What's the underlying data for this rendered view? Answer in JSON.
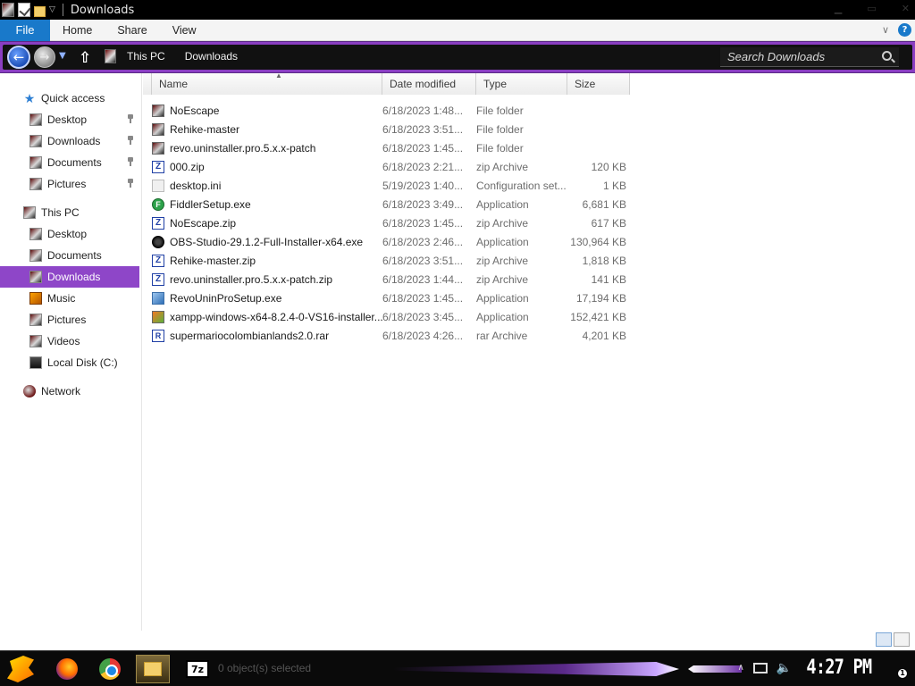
{
  "window": {
    "title": "Downloads",
    "controls": [
      "minimize-icon",
      "maximize-icon",
      "close-icon"
    ]
  },
  "ribbon": {
    "tabs": [
      {
        "label": "File",
        "active": true
      },
      {
        "label": "Home"
      },
      {
        "label": "Share"
      },
      {
        "label": "View"
      }
    ]
  },
  "addressbar": {
    "crumbs": [
      "This PC",
      "Downloads"
    ],
    "search_placeholder": "Search Downloads"
  },
  "sidebar": {
    "items": [
      {
        "label": "Quick access",
        "icon": "star-icon",
        "level": 0,
        "pinned": false
      },
      {
        "label": "Desktop",
        "icon": "desktop-icon",
        "level": 1,
        "pinned": true
      },
      {
        "label": "Downloads",
        "icon": "downloads-icon",
        "level": 1,
        "pinned": true
      },
      {
        "label": "Documents",
        "icon": "documents-icon",
        "level": 1,
        "pinned": true
      },
      {
        "label": "Pictures",
        "icon": "pictures-icon",
        "level": 1,
        "pinned": true
      },
      {
        "label": "This PC",
        "icon": "pc-icon",
        "level": 0,
        "pinned": false
      },
      {
        "label": "Desktop",
        "icon": "desktop-icon",
        "level": 1,
        "pinned": false
      },
      {
        "label": "Documents",
        "icon": "documents-icon",
        "level": 1,
        "pinned": false
      },
      {
        "label": "Downloads",
        "icon": "downloads-icon",
        "level": 1,
        "pinned": false,
        "selected": true
      },
      {
        "label": "Music",
        "icon": "music-icon",
        "level": 1,
        "pinned": false
      },
      {
        "label": "Pictures",
        "icon": "pictures-icon",
        "level": 1,
        "pinned": false
      },
      {
        "label": "Videos",
        "icon": "videos-icon",
        "level": 1,
        "pinned": false
      },
      {
        "label": "Local Disk (C:)",
        "icon": "disk-icon",
        "level": 1,
        "pinned": false
      },
      {
        "label": "Network",
        "icon": "network-icon",
        "level": 0,
        "pinned": false
      }
    ]
  },
  "columns": {
    "name": "Name",
    "date": "Date modified",
    "type": "Type",
    "size": "Size"
  },
  "files": [
    {
      "name": "NoEscape",
      "date": "6/18/2023 1:48...",
      "type": "File folder",
      "size": "",
      "icon": "folder"
    },
    {
      "name": "Rehike-master",
      "date": "6/18/2023 3:51...",
      "type": "File folder",
      "size": "",
      "icon": "folder"
    },
    {
      "name": "revo.uninstaller.pro.5.x.x-patch",
      "date": "6/18/2023 1:45...",
      "type": "File folder",
      "size": "",
      "icon": "folder"
    },
    {
      "name": "000.zip",
      "date": "6/18/2023 2:21...",
      "type": "zip Archive",
      "size": "120 KB",
      "icon": "zip"
    },
    {
      "name": "desktop.ini",
      "date": "5/19/2023 1:40...",
      "type": "Configuration set...",
      "size": "1 KB",
      "icon": "ini"
    },
    {
      "name": "FiddlerSetup.exe",
      "date": "6/18/2023 3:49...",
      "type": "Application",
      "size": "6,681 KB",
      "icon": "fiddler"
    },
    {
      "name": "NoEscape.zip",
      "date": "6/18/2023 1:45...",
      "type": "zip Archive",
      "size": "617 KB",
      "icon": "zip"
    },
    {
      "name": "OBS-Studio-29.1.2-Full-Installer-x64.exe",
      "date": "6/18/2023 2:46...",
      "type": "Application",
      "size": "130,964 KB",
      "icon": "obs"
    },
    {
      "name": "Rehike-master.zip",
      "date": "6/18/2023 3:51...",
      "type": "zip Archive",
      "size": "1,818 KB",
      "icon": "zip"
    },
    {
      "name": "revo.uninstaller.pro.5.x.x-patch.zip",
      "date": "6/18/2023 1:44...",
      "type": "zip Archive",
      "size": "141 KB",
      "icon": "zip"
    },
    {
      "name": "RevoUninProSetup.exe",
      "date": "6/18/2023 1:45...",
      "type": "Application",
      "size": "17,194 KB",
      "icon": "revo"
    },
    {
      "name": "xampp-windows-x64-8.2.4-0-VS16-installer....",
      "date": "6/18/2023 3:45...",
      "type": "Application",
      "size": "152,421 KB",
      "icon": "xampp"
    },
    {
      "name": "supermariocolombianlands2.0.rar",
      "date": "6/18/2023 4:26...",
      "type": "rar Archive",
      "size": "4,201 KB",
      "icon": "rar"
    }
  ],
  "statusbar": {
    "text": "0 object(s) selected"
  },
  "taskbar": {
    "apps": [
      "start-icon",
      "firefox-icon",
      "chrome-icon",
      "file-explorer-icon",
      "7zip-icon"
    ],
    "app_7z_label": "7z",
    "clock": "4:27 PM",
    "notification_count": "1"
  }
}
